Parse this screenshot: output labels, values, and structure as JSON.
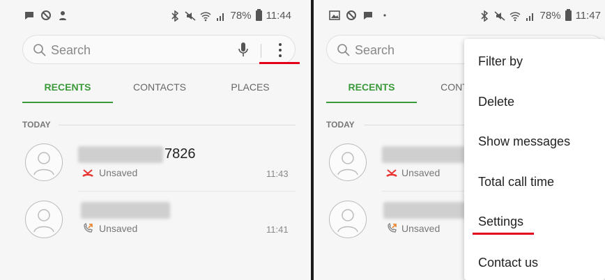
{
  "left_panel": {
    "status": {
      "battery_percent": "78%",
      "time": "11:44"
    },
    "search": {
      "placeholder": "Search"
    },
    "tabs": [
      {
        "label": "RECENTS",
        "active": true
      },
      {
        "label": "CONTACTS",
        "active": false
      },
      {
        "label": "PLACES",
        "active": false
      }
    ],
    "section_label": "TODAY",
    "calls": [
      {
        "name_suffix": "7826",
        "status": "Unsaved",
        "time": "11:43",
        "type": "missed"
      },
      {
        "name_suffix": "",
        "status": "Unsaved",
        "time": "11:41",
        "type": "outgoing"
      }
    ]
  },
  "right_panel": {
    "status": {
      "battery_percent": "78%",
      "time": "11:47"
    },
    "search": {
      "placeholder": "Search"
    },
    "tabs": [
      {
        "label": "RECENTS",
        "active": true
      },
      {
        "label": "CONT",
        "active": false
      }
    ],
    "section_label": "TODAY",
    "calls": [
      {
        "status": "Unsaved",
        "type": "missed"
      },
      {
        "status": "Unsaved",
        "type": "outgoing"
      }
    ],
    "menu": {
      "items": [
        "Filter by",
        "Delete",
        "Show messages",
        "Total call time",
        "Settings",
        "Contact us"
      ],
      "highlighted": "Settings"
    }
  },
  "colors": {
    "accent_green": "#3a9a3a",
    "highlight_red": "#e2001a",
    "missed_call": "#e8312f",
    "outgoing_call": "#e8832f"
  }
}
